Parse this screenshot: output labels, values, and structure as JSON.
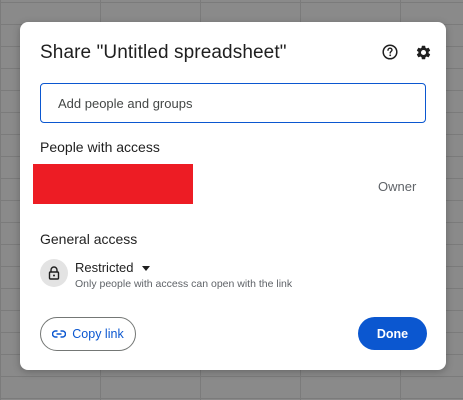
{
  "dialog": {
    "title": "Share \"Untitled spreadsheet\"",
    "help_icon": "help-circle-icon",
    "settings_icon": "gear-icon"
  },
  "add_people": {
    "placeholder": "Add people and groups"
  },
  "people_with_access": {
    "heading": "People with access",
    "entries": [
      {
        "role": "Owner"
      }
    ]
  },
  "general_access": {
    "heading": "General access",
    "icon": "lock-icon",
    "level": "Restricted",
    "description": "Only people with access can open with the link"
  },
  "actions": {
    "copy_link_label": "Copy link",
    "copy_link_icon": "link-icon",
    "done_label": "Done"
  },
  "colors": {
    "accent": "#0b57d0",
    "redaction": "#ed1c24"
  }
}
